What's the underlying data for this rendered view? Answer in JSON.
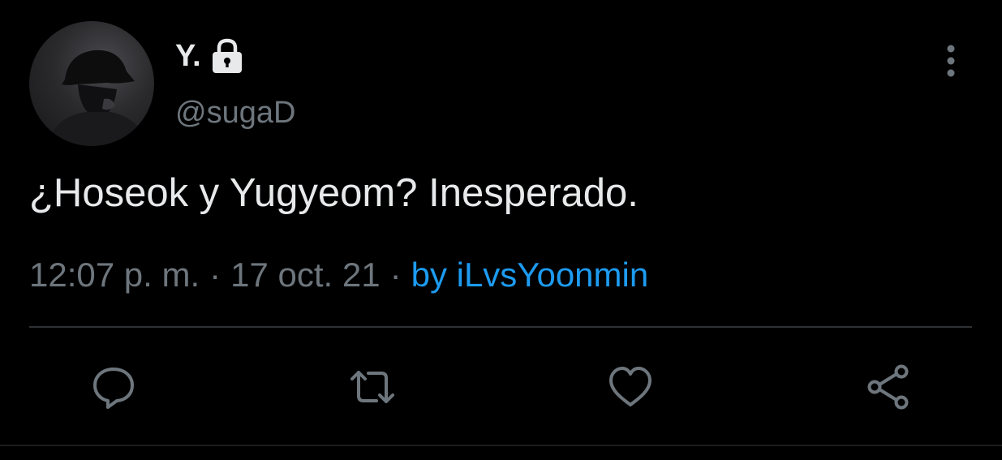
{
  "tweet": {
    "author": {
      "display_name": "Y.",
      "handle": "@sugaD",
      "protected_icon": "lock-icon",
      "avatar": "user-avatar-photo"
    },
    "text": "¿Hoseok y Yugyeom? Inesperado.",
    "time": "12:07 p. m.",
    "separator": "·",
    "date": "17 oct. 21",
    "source": "by iLvsYoonmin",
    "more_icon": "more-vertical-icon"
  },
  "actions": {
    "reply_icon": "reply-icon",
    "retweet_icon": "retweet-icon",
    "like_icon": "heart-icon",
    "share_icon": "share-icon"
  },
  "colors": {
    "background": "#000000",
    "primary_text": "#e7e9ea",
    "secondary_text": "#6e767d",
    "accent": "#1d9bf0",
    "divider": "#2f3336"
  }
}
